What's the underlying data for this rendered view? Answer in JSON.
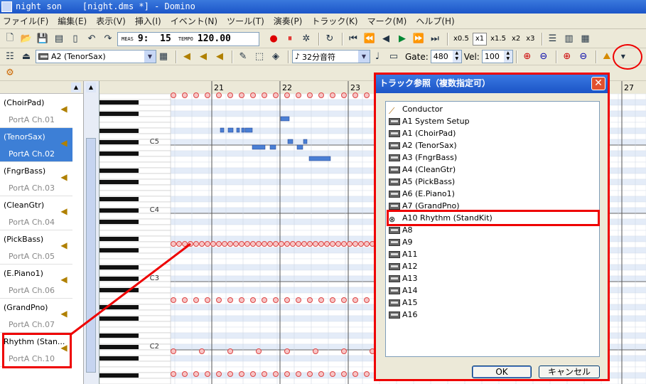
{
  "window": {
    "title": "night son    [night.dms *] - Domino"
  },
  "menu": [
    "ファイル(F)",
    "編集(E)",
    "表示(V)",
    "挿入(I)",
    "イベント(N)",
    "ツール(T)",
    "演奏(P)",
    "トラック(K)",
    "マーク(M)",
    "ヘルプ(H)"
  ],
  "transport": {
    "meas_label": "MEAS",
    "position": "9:  15",
    "tempo_label": "TEMPO",
    "tempo": "120.00"
  },
  "zoom": {
    "options": [
      "x0.5",
      "x1",
      "x1.5",
      "x2",
      "x3"
    ],
    "selected": "x1"
  },
  "editor": {
    "track_select": "A2  (TenorSax)",
    "note_length": "32分音符",
    "gate_label": "Gate:",
    "gate": "480",
    "vel_label": "Vel:",
    "vel": "100"
  },
  "tracks": [
    {
      "name": "(ChoirPad)",
      "port": "PortA  Ch.01",
      "selected": false
    },
    {
      "name": "(TenorSax)",
      "port": "PortA  Ch.02",
      "selected": true
    },
    {
      "name": "(FngrBass)",
      "port": "PortA  Ch.03",
      "selected": false
    },
    {
      "name": "(CleanGtr)",
      "port": "PortA  Ch.04",
      "selected": false
    },
    {
      "name": "(PickBass)",
      "port": "PortA  Ch.05",
      "selected": false
    },
    {
      "name": "(E.Piano1)",
      "port": "PortA  Ch.06",
      "selected": false
    },
    {
      "name": "(GrandPno)",
      "port": "PortA  Ch.07",
      "selected": false
    },
    {
      "name": "Rhythm (Stan...",
      "port": "PortA  Ch.10",
      "selected": false
    }
  ],
  "piano_roll": {
    "measures": [
      "21",
      "22",
      "23",
      "27"
    ],
    "octave_labels": [
      "C5",
      "C4",
      "C3",
      "C2"
    ]
  },
  "dialog": {
    "title": "トラック参照（複数指定可）",
    "items": [
      {
        "label": "Conductor",
        "icon": "baton-icon"
      },
      {
        "label": "A1 System Setup",
        "icon": "track-icon"
      },
      {
        "label": "A1  (ChoirPad)",
        "icon": "track-icon"
      },
      {
        "label": "A2  (TenorSax)",
        "icon": "track-icon"
      },
      {
        "label": "A3  (FngrBass)",
        "icon": "track-icon"
      },
      {
        "label": "A4  (CleanGtr)",
        "icon": "track-icon"
      },
      {
        "label": "A5  (PickBass)",
        "icon": "track-icon"
      },
      {
        "label": "A6  (E.Piano1)",
        "icon": "track-icon"
      },
      {
        "label": "A7  (GrandPno)",
        "icon": "track-icon"
      },
      {
        "label": "A10 Rhythm (StandKit)",
        "icon": "drum-icon",
        "highlighted": true
      },
      {
        "label": "A8",
        "icon": "track-icon"
      },
      {
        "label": "A9",
        "icon": "track-icon"
      },
      {
        "label": "A11",
        "icon": "track-icon"
      },
      {
        "label": "A12",
        "icon": "track-icon"
      },
      {
        "label": "A13",
        "icon": "track-icon"
      },
      {
        "label": "A14",
        "icon": "track-icon"
      },
      {
        "label": "A15",
        "icon": "track-icon"
      },
      {
        "label": "A16",
        "icon": "track-icon"
      }
    ],
    "ok": "OK",
    "cancel": "キャンセル"
  },
  "colors": {
    "accent": "#3d7fd6",
    "annotation": "#ee0000",
    "note_fill": "#4a7fd4",
    "drum_fill": "#f7c6c6"
  }
}
